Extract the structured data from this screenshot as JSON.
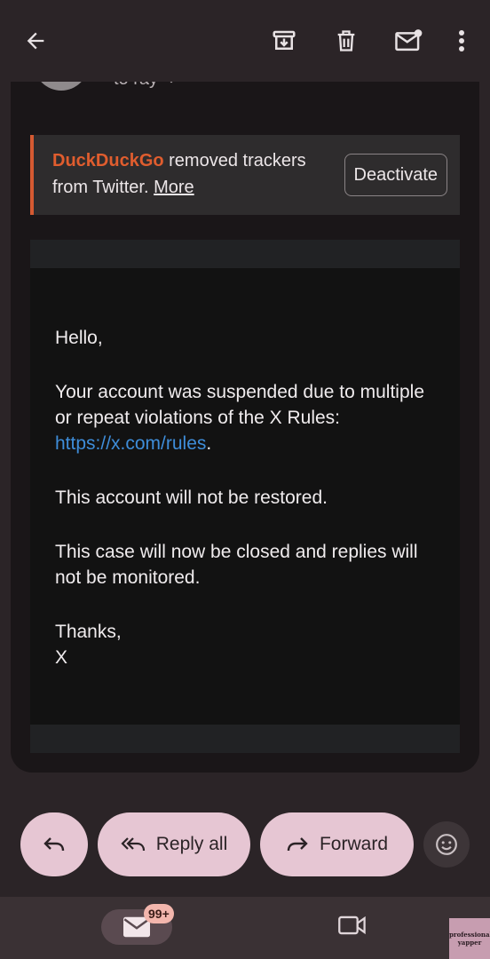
{
  "toolbar": {
    "back_icon": "arrow-left-icon",
    "archive_icon": "archive-icon",
    "delete_icon": "trash-icon",
    "mark_unread_icon": "mail-unread-icon",
    "more_icon": "more-vert-icon"
  },
  "header": {
    "to_line": "to ray"
  },
  "tracker_banner": {
    "brand": "DuckDuckGo",
    "text": " removed trackers from Twitter. ",
    "more_link": "More",
    "deactivate_label": "Deactivate",
    "accent_color": "#d55a32"
  },
  "message": {
    "greeting": "Hello,",
    "para1": "Your account was suspended due to multiple or repeat violations of the X Rules:",
    "rules_link": "https://x.com/rules",
    "rules_link_suffix": ".",
    "para2": "This account will not be restored.",
    "para3": "This case will now be closed and replies will not be monitored.",
    "signoff": "Thanks,",
    "signature": "X",
    "link_color": "#3e8dd9"
  },
  "actions": {
    "reply_icon": "reply-icon",
    "reply_all_label": "Reply all",
    "forward_label": "Forward",
    "emoji_icon": "emoji-icon",
    "pill_color": "#e6c6d3"
  },
  "bottom_nav": {
    "mail_badge": "99+",
    "mail_icon": "mail-icon",
    "meet_icon": "video-icon"
  },
  "watermark": {
    "text_line1": "professional",
    "text_line2": "yapper"
  }
}
